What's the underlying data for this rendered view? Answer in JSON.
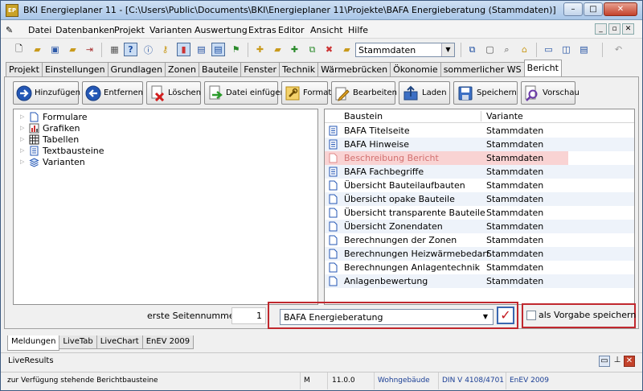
{
  "window": {
    "title": "BKI Energieplaner 11 - [C:\\Users\\Public\\Documents\\BKI\\Energieplaner 11\\Projekte\\BAFA Energieberatung (Stammdaten)]",
    "app_icon": "EP"
  },
  "menu": [
    "Datei",
    "Datenbanken",
    "Projekt",
    "Varianten",
    "Auswertung",
    "Extras",
    "Editor",
    "Ansicht",
    "Hilfe"
  ],
  "toolbar": {
    "combo_value": "Stammdaten"
  },
  "tabs": [
    "Projekt",
    "Einstellungen",
    "Grundlagen",
    "Zonen",
    "Bauteile",
    "Fenster",
    "Technik",
    "Wärmebrücken",
    "Ökonomie",
    "sommerlicher WS",
    "Bericht"
  ],
  "active_tab": "Bericht",
  "actions": [
    "Hinzufügen",
    "Entfernen",
    "Löschen",
    "Datei einfügen",
    "Format",
    "Bearbeiten",
    "Laden",
    "Speichern",
    "Vorschau"
  ],
  "tree": [
    "Formulare",
    "Grafiken",
    "Tabellen",
    "Textbausteine",
    "Varianten"
  ],
  "list": {
    "headers": [
      "Baustein",
      "Variante"
    ],
    "rows": [
      {
        "baustein": "BAFA Titelseite",
        "variante": "Stammdaten"
      },
      {
        "baustein": "BAFA Hinweise",
        "variante": "Stammdaten"
      },
      {
        "baustein": "Beschreibung Bericht",
        "variante": "Stammdaten"
      },
      {
        "baustein": "BAFA Fachbegriffe",
        "variante": "Stammdaten"
      },
      {
        "baustein": "Übersicht Bauteilaufbauten",
        "variante": "Stammdaten"
      },
      {
        "baustein": "Übersicht opake Bauteile",
        "variante": "Stammdaten"
      },
      {
        "baustein": "Übersicht transparente Bauteile",
        "variante": "Stammdaten"
      },
      {
        "baustein": "Übersicht Zonendaten",
        "variante": "Stammdaten"
      },
      {
        "baustein": "Berechnungen der Zonen",
        "variante": "Stammdaten"
      },
      {
        "baustein": "Berechnungen Heizwärmebedarf",
        "variante": "Stammdaten"
      },
      {
        "baustein": "Berechnungen Anlagentechnik",
        "variante": "Stammdaten"
      },
      {
        "baustein": "Anlagenbewertung",
        "variante": "Stammdaten"
      }
    ]
  },
  "footer": {
    "first_page_label": "erste Seitennummer",
    "first_page_value": "1",
    "template_value": "BAFA Energieberatung",
    "save_default_label": "als Vorgabe speichern"
  },
  "bottom_tabs": [
    "Meldungen",
    "LiveTab",
    "LiveChart",
    "EnEV 2009"
  ],
  "liveresults_label": "LiveResults",
  "status": [
    "zur Verfügung stehende Berichtbausteine",
    "M",
    "11.0.0",
    "Wohngebäude",
    "DIN V 4108/4701",
    "EnEV 2009"
  ],
  "colors": {
    "accent": "#c0282e",
    "highlight_row": "#f9d3d3",
    "link_blue": "#1b3f95"
  }
}
